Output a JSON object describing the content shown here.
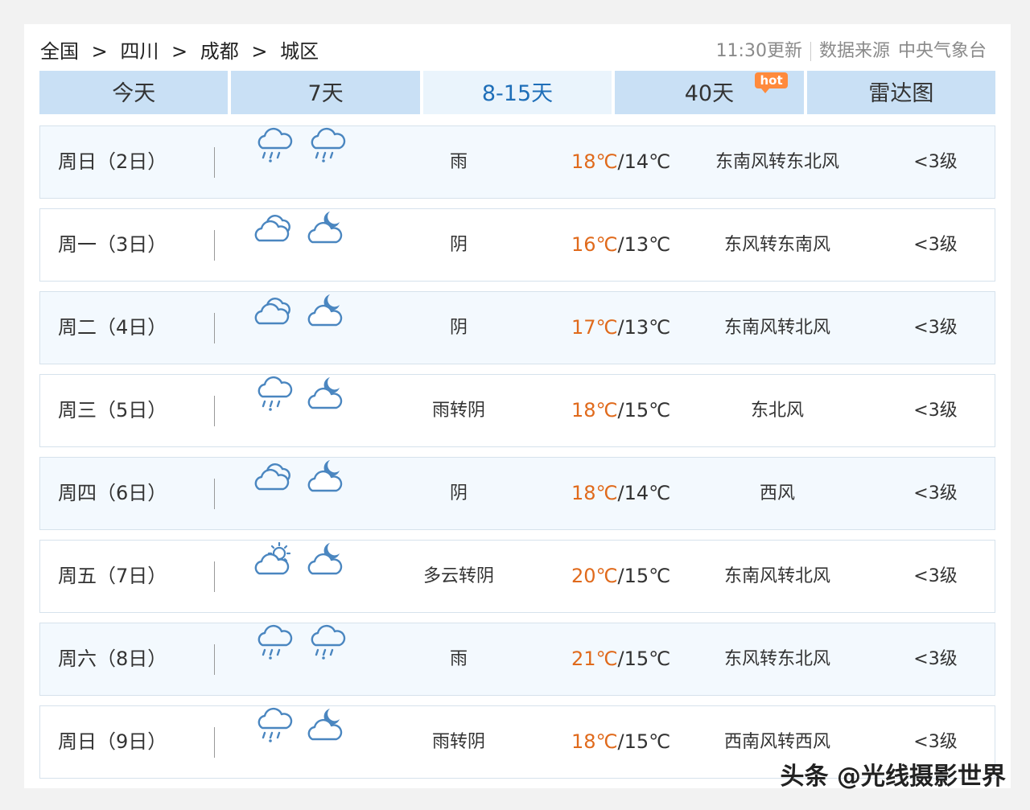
{
  "breadcrumb": [
    "全国",
    "四川",
    "成都",
    "城区"
  ],
  "breadcrumb_sep": ">",
  "update": "11:30更新",
  "source_label": "数据来源",
  "source": "中央气象台",
  "tabs": [
    {
      "label": "今天"
    },
    {
      "label": "7天"
    },
    {
      "label": "8-15天"
    },
    {
      "label": "40天",
      "badge": "hot"
    },
    {
      "label": "雷达图"
    }
  ],
  "active_tab": "8-15天",
  "colors": {
    "high_temp": "#e06a1c",
    "active_tab": "#1e6eb8",
    "tab_bg": "#c9e0f5",
    "icon": "#4a86c0"
  },
  "days": [
    {
      "day": "周日（2日）",
      "icons": [
        "rain-cloud-icon",
        "rain-cloud-icon"
      ],
      "weather": "雨",
      "high": "18℃",
      "low": "14℃",
      "wind": "东南风转东北风",
      "level": "<3级"
    },
    {
      "day": "周一（3日）",
      "icons": [
        "overcast-icon",
        "cloudy-night-icon"
      ],
      "weather": "阴",
      "high": "16℃",
      "low": "13℃",
      "wind": "东风转东南风",
      "level": "<3级"
    },
    {
      "day": "周二（4日）",
      "icons": [
        "overcast-icon",
        "cloudy-night-icon"
      ],
      "weather": "阴",
      "high": "17℃",
      "low": "13℃",
      "wind": "东南风转北风",
      "level": "<3级"
    },
    {
      "day": "周三（5日）",
      "icons": [
        "rain-cloud-icon",
        "cloudy-night-icon"
      ],
      "weather": "雨转阴",
      "high": "18℃",
      "low": "15℃",
      "wind": "东北风",
      "level": "<3级"
    },
    {
      "day": "周四（6日）",
      "icons": [
        "overcast-icon",
        "cloudy-night-icon"
      ],
      "weather": "阴",
      "high": "18℃",
      "low": "14℃",
      "wind": "西风",
      "level": "<3级"
    },
    {
      "day": "周五（7日）",
      "icons": [
        "partly-cloudy-icon",
        "cloudy-night-icon"
      ],
      "weather": "多云转阴",
      "high": "20℃",
      "low": "15℃",
      "wind": "东南风转北风",
      "level": "<3级"
    },
    {
      "day": "周六（8日）",
      "icons": [
        "rain-cloud-icon",
        "rain-cloud-icon"
      ],
      "weather": "雨",
      "high": "21℃",
      "low": "15℃",
      "wind": "东风转东北风",
      "level": "<3级"
    },
    {
      "day": "周日（9日）",
      "icons": [
        "rain-cloud-icon",
        "cloudy-night-icon"
      ],
      "weather": "雨转阴",
      "high": "18℃",
      "low": "15℃",
      "wind": "西南风转西风",
      "level": "<3级"
    }
  ],
  "watermark": "头条 @光线摄影世界"
}
